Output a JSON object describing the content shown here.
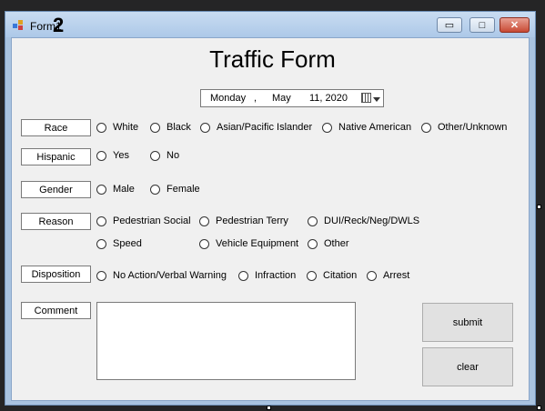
{
  "window": {
    "title": "Form1",
    "cursor_mark": "2"
  },
  "form": {
    "heading": "Traffic Form",
    "date": {
      "day": "Monday",
      "sep": ",",
      "month": "May",
      "daynum_year": "11, 2020"
    },
    "rows": [
      {
        "label": "Race",
        "options": [
          "White",
          "Black",
          "Asian/Pacific Islander",
          "Native American",
          "Other/Unknown"
        ]
      },
      {
        "label": "Hispanic",
        "options": [
          "Yes",
          "No"
        ]
      },
      {
        "label": "Gender",
        "options": [
          "Male",
          "Female"
        ]
      },
      {
        "label": "Reason",
        "options": [
          "Pedestrian Social",
          "Pedestrian Terry",
          "DUI/Reck/Neg/DWLS",
          "Speed",
          "Vehicle Equipment",
          "Other"
        ]
      },
      {
        "label": "Disposition",
        "options": [
          "No Action/Verbal Warning",
          "Infraction",
          "Citation",
          "Arrest"
        ]
      },
      {
        "label": "Comment"
      }
    ],
    "buttons": {
      "submit": "submit",
      "clear": "clear"
    }
  },
  "colors": {
    "titlebar": "#b9d1ee",
    "client": "#f0f0f0",
    "close_button": "#c84a34"
  }
}
